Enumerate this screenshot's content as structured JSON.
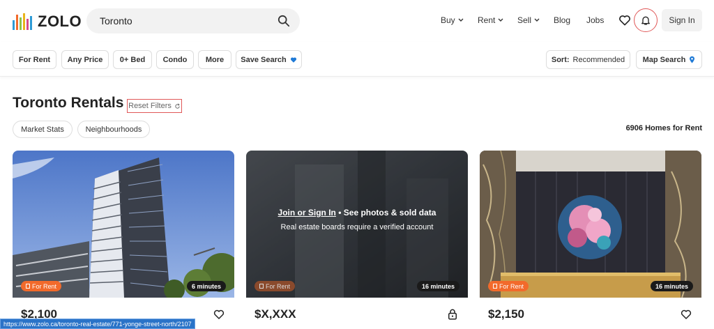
{
  "header": {
    "logo_text": "ZOLO",
    "search_value": "Toronto",
    "nav": {
      "buy": "Buy",
      "rent": "Rent",
      "sell": "Sell",
      "blog": "Blog",
      "jobs": "Jobs"
    },
    "signin": "Sign In"
  },
  "filters": {
    "for_rent": "For Rent",
    "any_price": "Any Price",
    "bed": "0+ Bed",
    "condo": "Condo",
    "more": "More",
    "save_search": "Save Search",
    "sort_label": "Sort:",
    "sort_value": "Recommended",
    "map_search": "Map Search"
  },
  "page": {
    "title": "Toronto Rentals",
    "reset_filters": "Reset Filters",
    "market_stats": "Market Stats",
    "neighbourhoods": "Neighbourhoods",
    "count": "6906 Homes for Rent"
  },
  "cards": [
    {
      "badge": "For Rent",
      "time": "6 minutes",
      "price": "$2,100",
      "sub": ""
    },
    {
      "badge": "For Rent",
      "time": "16 minutes",
      "price": "$X,XXX",
      "sub": "",
      "overlay_link": "Join or Sign In",
      "overlay_rest": " • See photos & sold data",
      "overlay_line2": "Real estate boards require a verified account"
    },
    {
      "badge": "For Rent",
      "time": "16 minutes",
      "price": "$2,150",
      "sub": ""
    }
  ],
  "status_url": "https://www.zolo.ca/toronto-real-estate/771-yonge-street-north/2107",
  "colors": {
    "accent_orange": "#f26a2b",
    "focus_red": "#e05757",
    "status_blue": "#2a73c8"
  }
}
